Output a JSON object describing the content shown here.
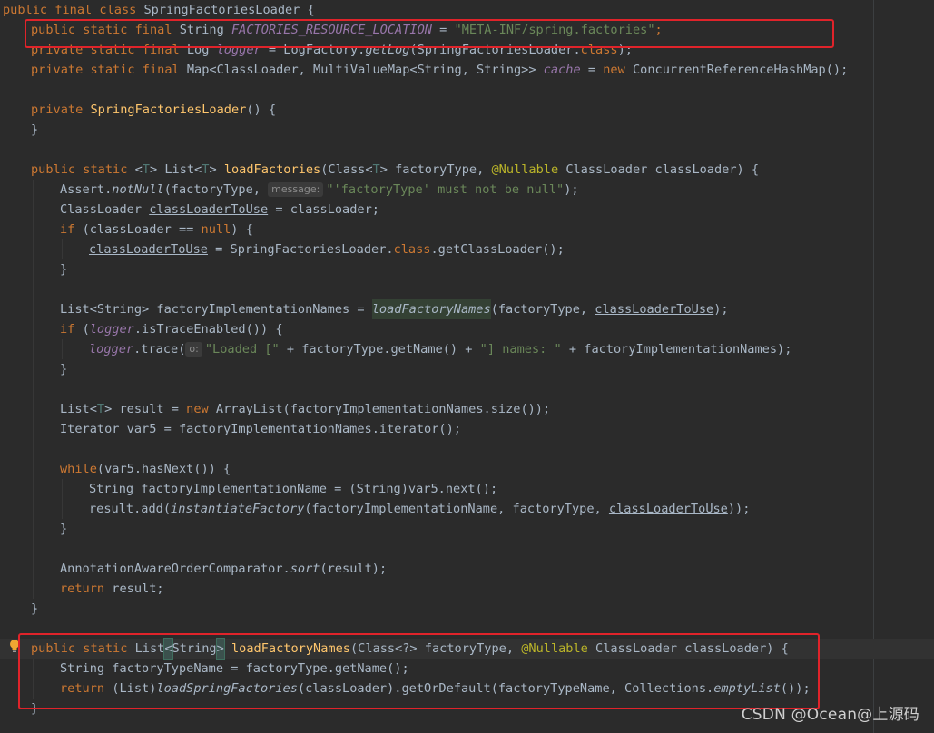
{
  "editor": {
    "theme_colors": {
      "background": "#2b2b2b",
      "keyword": "#cc7832",
      "method": "#ffc66d",
      "string": "#6a8759",
      "field": "#9876aa",
      "annotation": "#bbb529",
      "highlight_box": "#e0232a"
    },
    "lines": {
      "l1": {
        "a": "public final class ",
        "b": "SpringFactoriesLoader {"
      },
      "l2": {
        "a": "public static final ",
        "b": "String ",
        "c": "FACTORIES_RESOURCE_LOCATION",
        "d": " = ",
        "e": "\"META-INF/spring.factories\"",
        "f": ";"
      },
      "l3": {
        "a": "private static final ",
        "b": "Log ",
        "c": "logger",
        "d": " = LogFactory.",
        "e": "getLog",
        "f": "(SpringFactoriesLoader.",
        "g": "class",
        "h": ");"
      },
      "l4": {
        "a": "private static final ",
        "b": "Map<ClassLoader, MultiValueMap<String, String>> ",
        "c": "cache",
        "d": " = ",
        "e": "new ",
        "f": "ConcurrentReferenceHashMap();"
      },
      "l6": {
        "a": "private ",
        "b": "SpringFactoriesLoader",
        "c": "() {"
      },
      "l7": {
        "a": "}"
      },
      "l9": {
        "a": "public static ",
        "b": "<",
        "c": "T",
        "d": "> List<",
        "e": "T",
        "f": "> ",
        "g": "loadFactories",
        "h": "(Class<",
        "i": "T",
        "j": "> factoryType, ",
        "k": "@Nullable ",
        "l": "ClassLoader classLoader) {"
      },
      "l10": {
        "a": "Assert.",
        "b": "notNull",
        "c": "(factoryType, ",
        "hint": "message:",
        "d": "\"'factoryType' must not be null\"",
        "e": ");"
      },
      "l11": {
        "a": "ClassLoader ",
        "b": "classLoaderToUse",
        "c": " = classLoader;"
      },
      "l12": {
        "a": "if ",
        "b": "(classLoader == ",
        "c": "null",
        "d": ") {"
      },
      "l13": {
        "a": "classLoaderToUse",
        "b": " = SpringFactoriesLoader.",
        "c": "class",
        "d": ".getClassLoader();"
      },
      "l14": {
        "a": "}"
      },
      "l16": {
        "a": "List<String> factoryImplementationNames = ",
        "b": "loadFactoryNames",
        "c": "(factoryType, ",
        "d": "classLoaderToUse",
        "e": ");"
      },
      "l17": {
        "a": "if ",
        "b": "(",
        "c": "logger",
        "d": ".isTraceEnabled()) {"
      },
      "l18": {
        "a": "logger",
        "b": ".trace(",
        "hint": "o:",
        "c": "\"Loaded [\"",
        "d": " + factoryType.getName() + ",
        "e": "\"] names: \"",
        "f": " + factoryImplementationNames);"
      },
      "l19": {
        "a": "}"
      },
      "l21": {
        "a": "List<",
        "b": "T",
        "c": "> result = ",
        "d": "new ",
        "e": "ArrayList(factoryImplementationNames.size());"
      },
      "l22": {
        "a": "Iterator var5 = factoryImplementationNames.iterator();"
      },
      "l24": {
        "a": "while",
        "b": "(var5.hasNext()) {"
      },
      "l25": {
        "a": "String factoryImplementationName = (String)var5.next();"
      },
      "l26": {
        "a": "result.add(",
        "b": "instantiateFactory",
        "c": "(factoryImplementationName, factoryType, ",
        "d": "classLoaderToUse",
        "e": "));"
      },
      "l27": {
        "a": "}"
      },
      "l29": {
        "a": "AnnotationAwareOrderComparator.",
        "b": "sort",
        "c": "(result);"
      },
      "l30": {
        "a": "return ",
        "b": "result;"
      },
      "l31": {
        "a": "}"
      },
      "l33": {
        "a": "public static ",
        "b": "List",
        "c": "<",
        "d": "String",
        "e": ">",
        "f": " ",
        "g": "loadFactoryNames",
        "h": "(Class<?> factoryType, ",
        "i": "@Nullable ",
        "j": "ClassLoader classLoader) {"
      },
      "l34": {
        "a": "String factoryTypeName = factoryType.getName();"
      },
      "l35": {
        "a": "return ",
        "b": "(List)",
        "c": "loadSpringFactories",
        "d": "(classLoader).getOrDefault(factoryTypeName, Collections.",
        "e": "emptyList",
        "f": "());"
      },
      "l36": {
        "a": "}"
      }
    }
  },
  "watermark": "CSDN @Ocean@上源码",
  "icons": {
    "intention": "lightbulb-icon"
  }
}
